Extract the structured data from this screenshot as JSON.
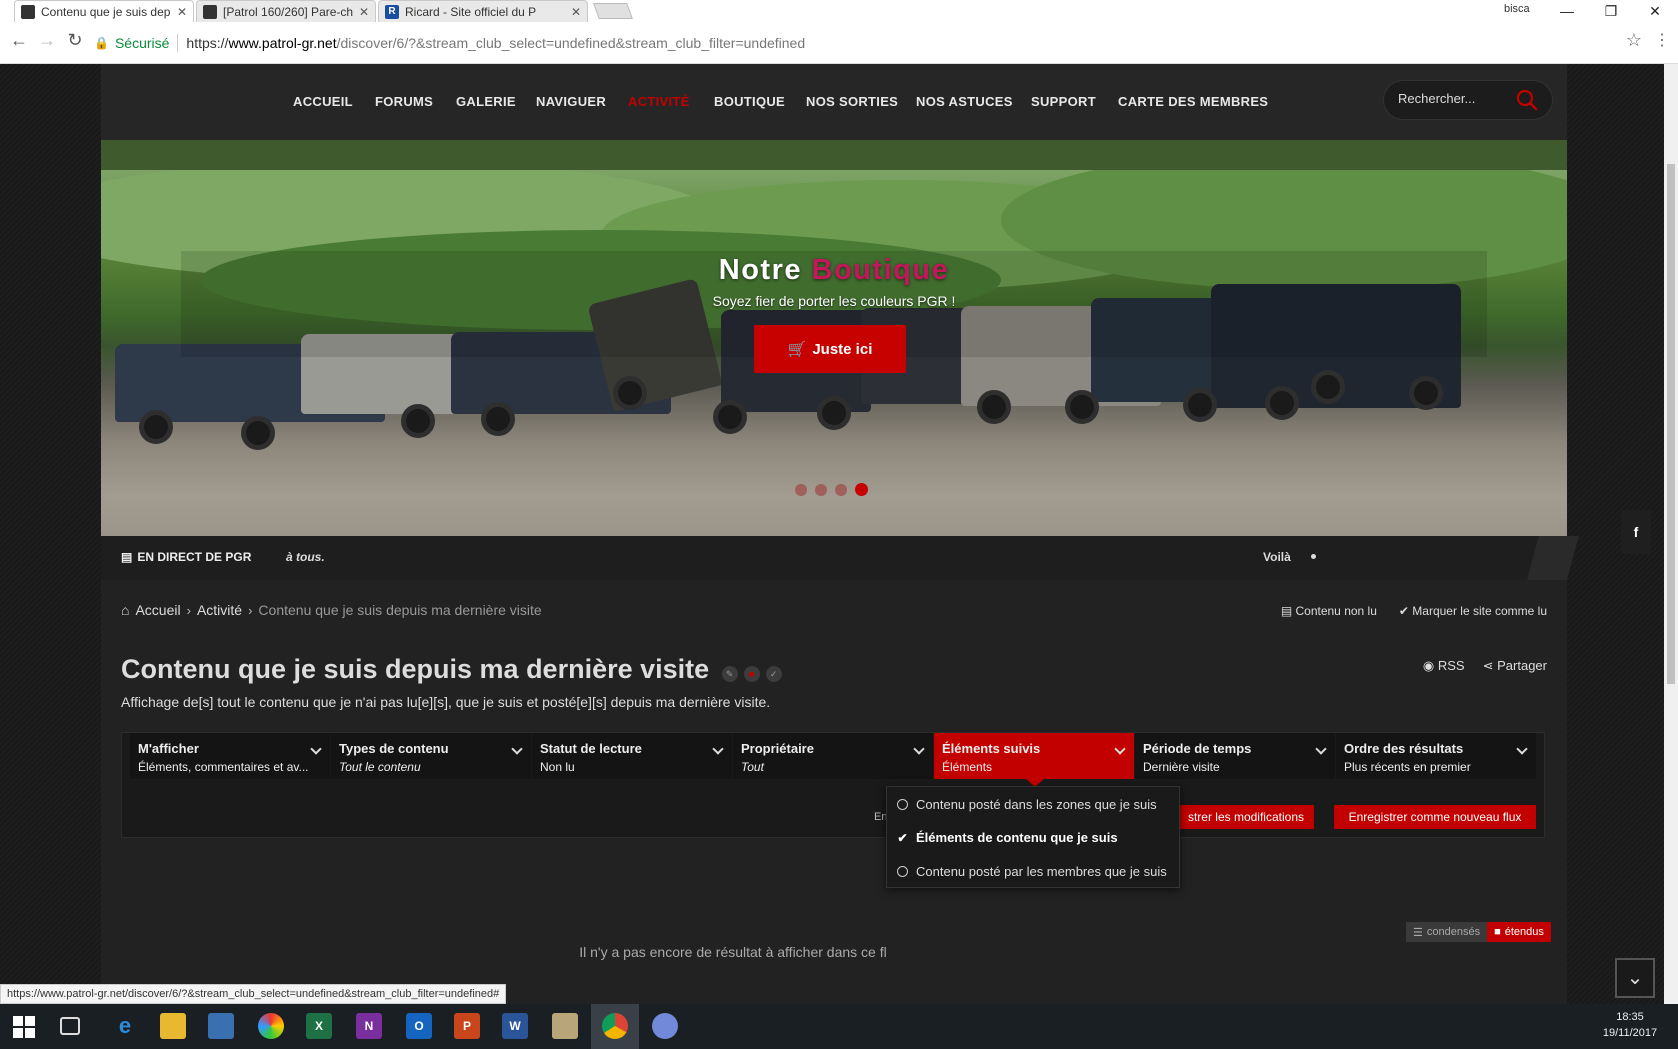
{
  "browser": {
    "tabs": [
      {
        "title": "Contenu que je suis depu",
        "active": true,
        "icon": "site-favicon"
      },
      {
        "title": "[Patrol 160/260] Pare-ch",
        "active": false,
        "icon": "site-favicon"
      },
      {
        "title": "Ricard - Site officiel du P",
        "active": false,
        "icon": "ricard-favicon"
      }
    ],
    "user": "bisca",
    "secure_label": "Sécurisé",
    "url_scheme": "https://",
    "url_host": "www.patrol-gr.net",
    "url_path": "/discover/6/?&stream_club_select=undefined&stream_club_filter=undefined",
    "status_url": "https://www.patrol-gr.net/discover/6/?&stream_club_select=undefined&stream_club_filter=undefined#"
  },
  "nav": {
    "items": [
      {
        "label": "ACCUEIL",
        "active": false
      },
      {
        "label": "FORUMS",
        "active": false
      },
      {
        "label": "GALERIE",
        "active": false
      },
      {
        "label": "NAVIGUER",
        "active": false
      },
      {
        "label": "ACTIVITÉ",
        "active": true
      },
      {
        "label": "BOUTIQUE",
        "active": false
      },
      {
        "label": "NOS SORTIES",
        "active": false
      },
      {
        "label": "NOS ASTUCES",
        "active": false
      },
      {
        "label": "SUPPORT",
        "active": false
      },
      {
        "label": "CARTE DES MEMBRES",
        "active": false
      }
    ],
    "search_placeholder": "Rechercher..."
  },
  "hero": {
    "title_a": "Notre",
    "title_b": "Boutique",
    "subtitle": "Soyez fier de porter les couleurs PGR !",
    "button": "Juste ici",
    "slides": 4,
    "active_slide": 4
  },
  "ticker": {
    "label": "EN DIRECT DE PGR",
    "message": "à tous.",
    "message2": "Voilà"
  },
  "breadcrumb": {
    "home": "Accueil",
    "section": "Activité",
    "current": "Contenu que je suis depuis ma dernière visite",
    "unread": "Contenu non lu",
    "mark_read": "Marquer le site comme lu"
  },
  "header": {
    "title": "Contenu que je suis depuis ma dernière visite",
    "description": "Affichage de[s] tout le contenu que je n'ai pas lu[e][s], que je suis et posté[e][s] depuis ma dernière visite.",
    "rss": "RSS",
    "share": "Partager"
  },
  "filters": [
    {
      "label": "M'afficher",
      "value": "Éléments, commentaires et av...",
      "italic": false,
      "selected": false
    },
    {
      "label": "Types de contenu",
      "value": "Tout le contenu",
      "italic": true,
      "selected": false
    },
    {
      "label": "Statut de lecture",
      "value": "Non lu",
      "italic": false,
      "selected": false
    },
    {
      "label": "Propriétaire",
      "value": "Tout",
      "italic": true,
      "selected": false
    },
    {
      "label": "Éléments suivis",
      "value": "Éléments",
      "italic": false,
      "selected": true
    },
    {
      "label": "Période de temps",
      "value": "Dernière visite",
      "italic": false,
      "selected": false
    },
    {
      "label": "Ordre des résultats",
      "value": "Plus récents en premier",
      "italic": false,
      "selected": false
    }
  ],
  "actions": {
    "hint": "Enregi",
    "save": "strer les modifications",
    "save_new": "Enregistrer comme nouveau flux"
  },
  "dropdown": [
    {
      "label": "Contenu posté dans les zones que je suis",
      "checked": false
    },
    {
      "label": "Éléments de contenu que je suis",
      "checked": true
    },
    {
      "label": "Contenu posté par les membres que je suis",
      "checked": false
    }
  ],
  "view": {
    "condensed": "condensés",
    "expanded": "étendus"
  },
  "empty_message": "Il n'y a pas encore de résultat à afficher dans ce fl",
  "social": {
    "facebook": "f"
  },
  "clock": {
    "time": "18:35",
    "date": "19/11/2017"
  },
  "colors": {
    "accent": "#c20000",
    "hero_accent": "#c2185b",
    "background": "#222222"
  }
}
